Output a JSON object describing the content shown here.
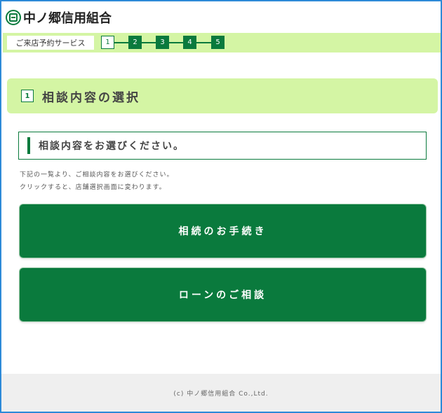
{
  "header": {
    "logo_icon": "credit-union-logo-icon",
    "brand_name": "中ノ郷信用組合"
  },
  "steps": {
    "service_label": "ご来店予約サービス",
    "current": 1,
    "items": [
      "1",
      "2",
      "3",
      "4",
      "5"
    ]
  },
  "section": {
    "number": "1",
    "title": "相談内容の選択"
  },
  "subheading": {
    "text": "相談内容をお選びください。"
  },
  "description": {
    "line1": "下記の一覧より、ご相談内容をお選びください。",
    "line2": "クリックすると、店舗選択画面に変わります。"
  },
  "options": {
    "inheritance_label": "相続のお手続き",
    "loan_label": "ローンのご相談"
  },
  "footer": {
    "copyright": "(c) 中ノ郷信用組合 Co.,Ltd."
  },
  "colors": {
    "primary_green": "#0a7a3d",
    "light_green": "#d4f5a4",
    "frame_blue": "#2d8ad8"
  }
}
